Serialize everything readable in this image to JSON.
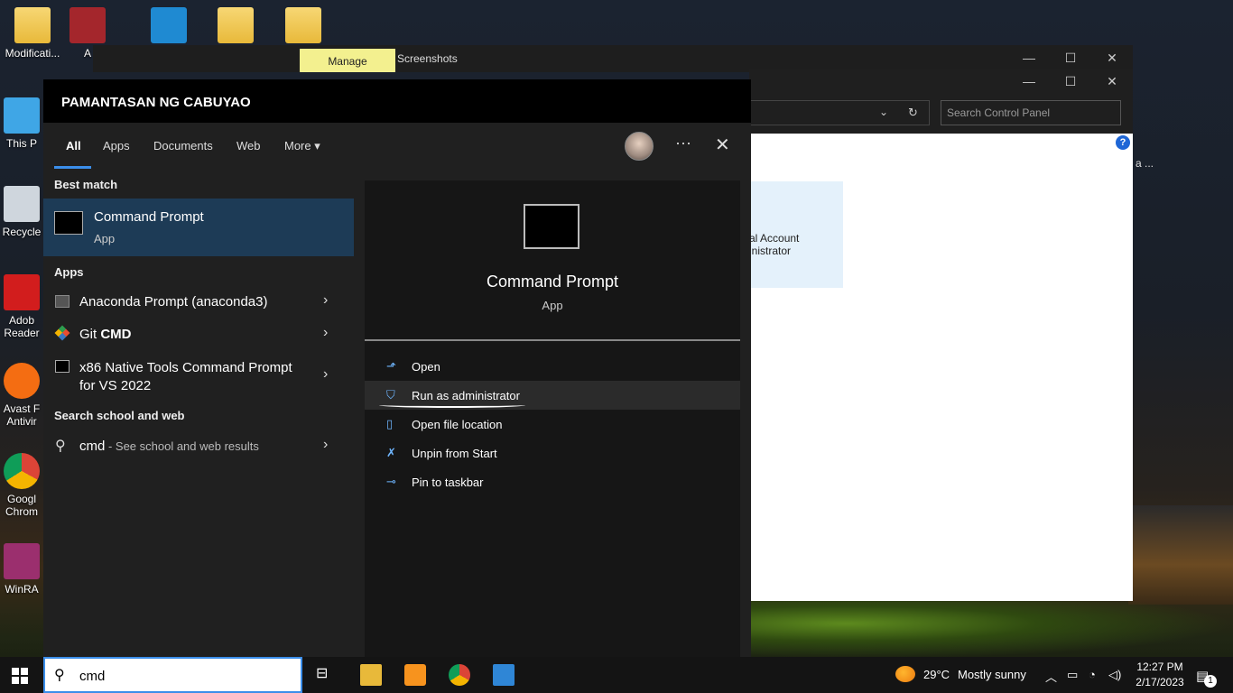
{
  "desktop": {
    "icons": [
      {
        "label": "Modificati..."
      },
      {
        "label": "A"
      },
      {
        "label": "This P"
      },
      {
        "label": "Recycle"
      },
      {
        "label": "Adob Reader"
      },
      {
        "label": "Avast F Antivir"
      },
      {
        "label": "Googl Chrom"
      },
      {
        "label": "WinRA"
      }
    ]
  },
  "explorer": {
    "manage_tab": "Manage",
    "title": "Screenshots"
  },
  "control_panel": {
    "search_placeholder": "Search Control Panel",
    "account_line1": "al Account",
    "account_line2": "inistrator",
    "help": "?",
    "edge_text": "a ..."
  },
  "start": {
    "org": "PAMANTASAN NG CABUYAO",
    "tabs": [
      "All",
      "Apps",
      "Documents",
      "Web",
      "More"
    ],
    "more_caret": "▾",
    "dots": "···",
    "close": "✕",
    "best_match_header": "Best match",
    "best_match": {
      "name": "Command Prompt",
      "sub": "App"
    },
    "apps_header": "Apps",
    "apps": [
      {
        "name": "Anaconda Prompt (anaconda3)"
      },
      {
        "name_prefix": "Git ",
        "name_bold": "CMD"
      },
      {
        "name_line1": "x86 Native Tools Command Prompt",
        "name_line2": "for VS 2022"
      }
    ],
    "search_web_header": "Search school and web",
    "web_result": {
      "query": "cmd",
      "suffix": " - See school and web results"
    },
    "chevron": "›",
    "detail": {
      "title": "Command Prompt",
      "sub": "App",
      "actions": [
        {
          "label": "Open",
          "icon": "open-icon"
        },
        {
          "label": "Run as administrator",
          "icon": "shield-icon"
        },
        {
          "label": "Open file location",
          "icon": "file-location-icon"
        },
        {
          "label": "Unpin from Start",
          "icon": "unpin-icon"
        },
        {
          "label": "Pin to taskbar",
          "icon": "pin-icon"
        }
      ]
    }
  },
  "taskbar": {
    "search_value": "cmd",
    "weather_temp": "29°C",
    "weather_desc": "Mostly sunny",
    "time": "12:27 PM",
    "date": "2/17/2023",
    "notifications": "1"
  }
}
